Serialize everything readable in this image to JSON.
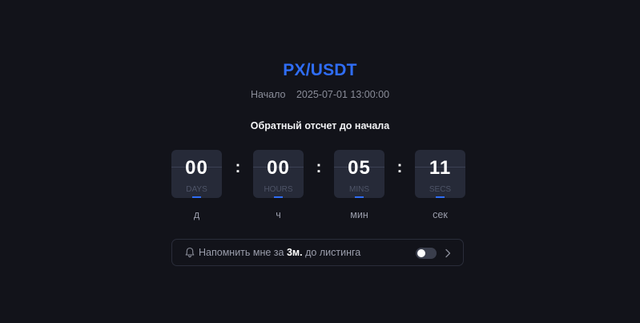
{
  "header": {
    "pair": "PX/USDT",
    "start_label": "Начало",
    "start_datetime": "2025-07-01 13:00:00",
    "countdown_heading": "Обратный отсчет до начала"
  },
  "countdown": {
    "days": {
      "value": "00",
      "unit_en": "DAYS",
      "unit_ru": "д"
    },
    "hours": {
      "value": "00",
      "unit_en": "HOURS",
      "unit_ru": "ч"
    },
    "mins": {
      "value": "05",
      "unit_en": "MINS",
      "unit_ru": "мин"
    },
    "secs": {
      "value": "11",
      "unit_en": "SECS",
      "unit_ru": "сек"
    },
    "separator": ":"
  },
  "reminder": {
    "prefix": "Напомнить мне за ",
    "lead_time": "3м.",
    "suffix": " до листинга",
    "enabled": false,
    "icons": {
      "bell": "bell-icon",
      "chevron": "chevron-right-icon"
    }
  },
  "colors": {
    "accent": "#2f6df6",
    "background": "#12131a",
    "tile": "#262a38"
  }
}
